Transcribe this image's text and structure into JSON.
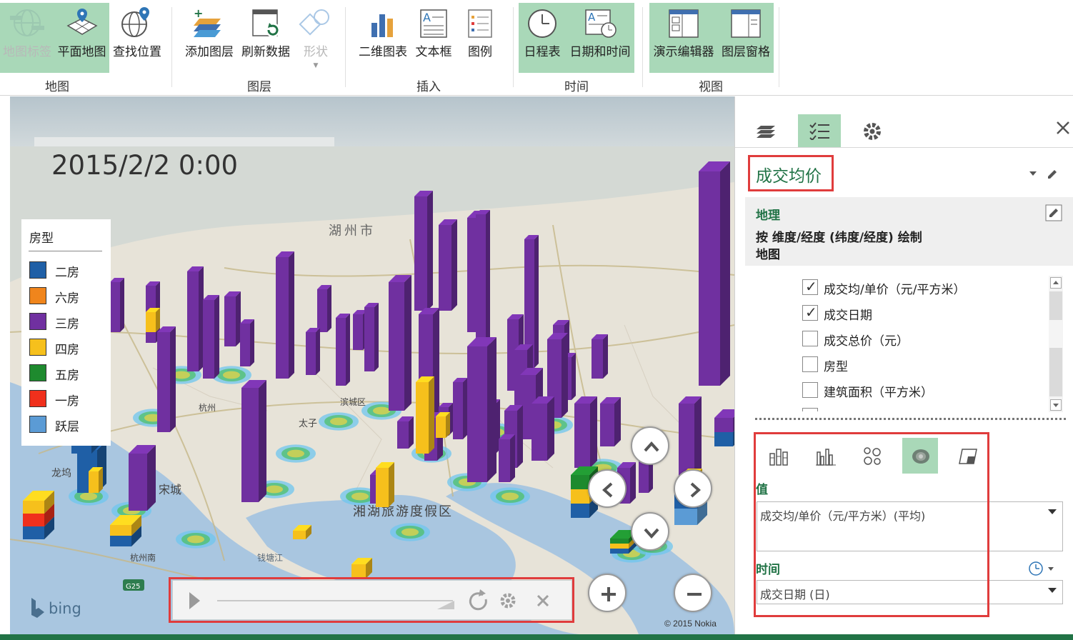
{
  "ribbon": {
    "groups": [
      {
        "label": "地图",
        "buttons": [
          {
            "label": "地图标签",
            "icon": "globe-labels-icon",
            "state": "active-disabled"
          },
          {
            "label": "平面地图",
            "icon": "flat-map-icon",
            "state": "active"
          },
          {
            "label": "查找位置",
            "icon": "find-location-icon",
            "state": "normal"
          }
        ]
      },
      {
        "label": "图层",
        "buttons": [
          {
            "label": "添加图层",
            "icon": "add-layer-icon",
            "state": "normal"
          },
          {
            "label": "刷新数据",
            "icon": "refresh-data-icon",
            "state": "normal"
          },
          {
            "label": "形状",
            "icon": "shapes-icon",
            "state": "disabled"
          }
        ]
      },
      {
        "label": "插入",
        "buttons": [
          {
            "label": "二维图表",
            "icon": "bar-chart-icon",
            "state": "normal"
          },
          {
            "label": "文本框",
            "icon": "text-box-icon",
            "state": "normal"
          },
          {
            "label": "图例",
            "icon": "legend-icon",
            "state": "normal"
          }
        ]
      },
      {
        "label": "时间",
        "buttons": [
          {
            "label": "日程表",
            "icon": "clock-icon",
            "state": "active"
          },
          {
            "label": "日期和时间",
            "icon": "date-time-icon",
            "state": "active"
          }
        ]
      },
      {
        "label": "视图",
        "buttons": [
          {
            "label": "演示编辑器",
            "icon": "tour-editor-icon",
            "state": "active"
          },
          {
            "label": "图层窗格",
            "icon": "layer-pane-icon",
            "state": "active"
          }
        ]
      }
    ]
  },
  "map": {
    "timestamp": "2015/2/2 0:00",
    "legend": {
      "title": "房型",
      "items": [
        {
          "name": "二房",
          "color": "#1f5fa6"
        },
        {
          "name": "六房",
          "color": "#f0851c"
        },
        {
          "name": "三房",
          "color": "#7030a0"
        },
        {
          "name": "四房",
          "color": "#f6c01c"
        },
        {
          "name": "五房",
          "color": "#1e8a2e"
        },
        {
          "name": "一房",
          "color": "#f0301c"
        },
        {
          "name": "跃层",
          "color": "#5b9bd5"
        }
      ]
    },
    "labels": {
      "lake": "湘湖旅游度假区",
      "north": "湖州市",
      "hangzhou": "杭州",
      "city": "滨城区",
      "taizi": "太子",
      "songcheng": "宋城",
      "longwu": "龙坞",
      "hz_road": "杭州南",
      "g25": "G25",
      "chuanjiang": "钱塘江"
    },
    "bing_logo": "bing",
    "copyright": "© 2015 Nokia"
  },
  "pane": {
    "layer_name": "成交均价",
    "geography": {
      "heading": "地理",
      "line1": "按 维度/经度 (纬度/经度) 绘制",
      "line2": "地图"
    },
    "fields": [
      {
        "label": "成交均/单价（元/平方米）",
        "checked": true
      },
      {
        "label": "成交日期",
        "checked": true
      },
      {
        "label": "成交总价（元）",
        "checked": false
      },
      {
        "label": "房型",
        "checked": false
      },
      {
        "label": "建筑面积（平方米）",
        "checked": false
      },
      {
        "label": "经度",
        "checked": false
      }
    ],
    "value_section": "值",
    "value_field": "成交均/单价（元/平方米）(平均)",
    "time_section": "时间",
    "time_field": "成交日期 (日)"
  },
  "colors": {
    "accent": "#217346",
    "active_bg": "#a9d8b8",
    "highlight_box": "#e03c3c",
    "water": "#a9c6e0"
  }
}
